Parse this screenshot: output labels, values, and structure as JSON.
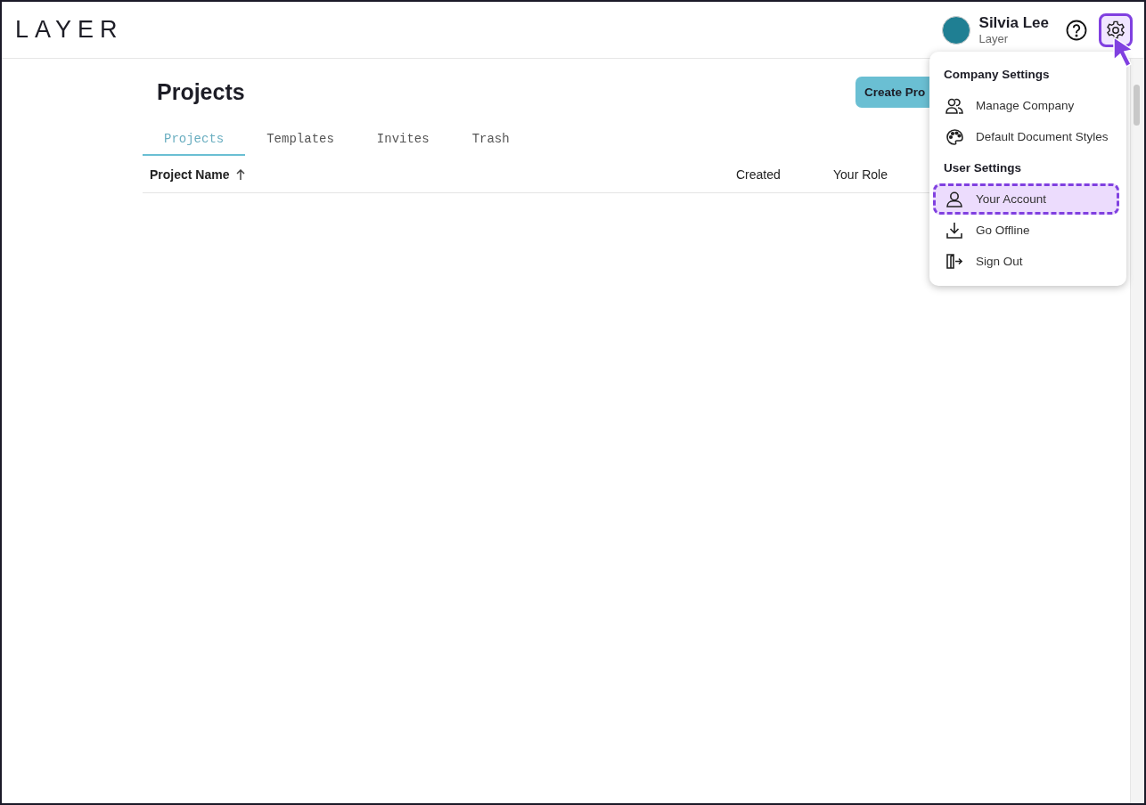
{
  "header": {
    "logo": "LAYER",
    "user": {
      "name": "Silvia Lee",
      "org": "Layer"
    },
    "settings_button": {
      "highlighted": true
    }
  },
  "page": {
    "title": "Projects",
    "create_button": "Create Pro"
  },
  "tabs": [
    {
      "label": "Projects",
      "selected": true
    },
    {
      "label": "Templates",
      "selected": false
    },
    {
      "label": "Invites",
      "selected": false
    },
    {
      "label": "Trash",
      "selected": false
    }
  ],
  "table": {
    "columns": [
      {
        "label": "Project Name",
        "sorted": true
      },
      {
        "label": "Created",
        "sorted": false
      },
      {
        "label": "Your Role",
        "sorted": false
      }
    ]
  },
  "settings_menu": {
    "sections": [
      {
        "title": "Company Settings",
        "items": [
          {
            "label": "Manage Company",
            "highlighted": false
          },
          {
            "label": "Default Document Styles",
            "highlighted": false
          }
        ]
      },
      {
        "title": "User Settings",
        "items": [
          {
            "label": "Your Account",
            "highlighted": true
          },
          {
            "label": "Go Offline",
            "highlighted": false
          },
          {
            "label": "Sign Out",
            "highlighted": false
          }
        ]
      }
    ]
  }
}
